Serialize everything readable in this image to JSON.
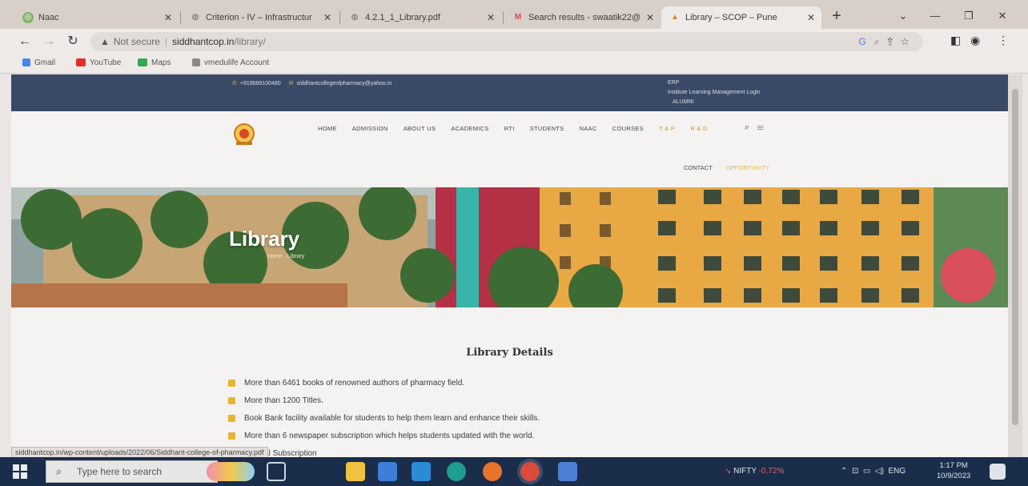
{
  "browser": {
    "tabs": [
      {
        "title": "Naac",
        "active": false
      },
      {
        "title": "Criterion - IV – Infrastructur",
        "active": false
      },
      {
        "title": "4.2.1_1_Library.pdf",
        "active": false
      },
      {
        "title": "Search results - swaatik22@",
        "active": false
      },
      {
        "title": "Library – SCOP – Pune",
        "active": true
      }
    ],
    "new_tab_label": "+",
    "address": {
      "security_label": "Not secure",
      "host": "siddhantcop.in",
      "path": "/library/"
    },
    "bookmarks": [
      {
        "label": "Gmail",
        "color": "#4285f4"
      },
      {
        "label": "YouTube",
        "color": "#e52d27"
      },
      {
        "label": "Maps",
        "color": "#34a853"
      },
      {
        "label": "vmedulife Account",
        "color": "#8a8a8a"
      }
    ]
  },
  "site": {
    "topbar": {
      "phone": "+919689100480",
      "email": "siddhantcollegeofpharmacy@yahoo.in",
      "links": [
        "ERP",
        "Institute Learning Management Login",
        "ALUMNI"
      ]
    },
    "nav": [
      "HOME",
      "ADMISSION",
      "ABOUT US",
      "ACADEMICS",
      "RTI",
      "STUDENTS",
      "NAAC",
      "COURSES",
      "T & P",
      "R & D"
    ],
    "subnav": {
      "contact": "CONTACT",
      "opportunity": "OPPORTUNITY"
    },
    "banner": {
      "title": "Library",
      "crumb": "Home · Library"
    },
    "section_title": "Library Details",
    "details": [
      "More than 6461 books of renowned authors of pharmacy field.",
      "More than 1200 Titles.",
      "Book Bank facility available for students to help them learn and enhance their skills.",
      "More than 6 newspaper subscription which helps students updated with the world.",
      "Journal Subscription"
    ]
  },
  "status_url": "siddhantcop.in/wp-content/uploads/2022/06/Siddhant-college-of-pharmacy.pdf",
  "taskbar": {
    "search_placeholder": "Type here to search",
    "ticker_name": "NIFTY",
    "ticker_change": "-0.72%",
    "language": "ENG",
    "time": "1:17 PM",
    "date": "10/9/2023"
  },
  "colors": {
    "topbar_bg": "#3a4a66",
    "accent_gold": "#e6b632",
    "taskbar_bg": "#1a2d4b",
    "ticker_negative": "#e06060"
  }
}
